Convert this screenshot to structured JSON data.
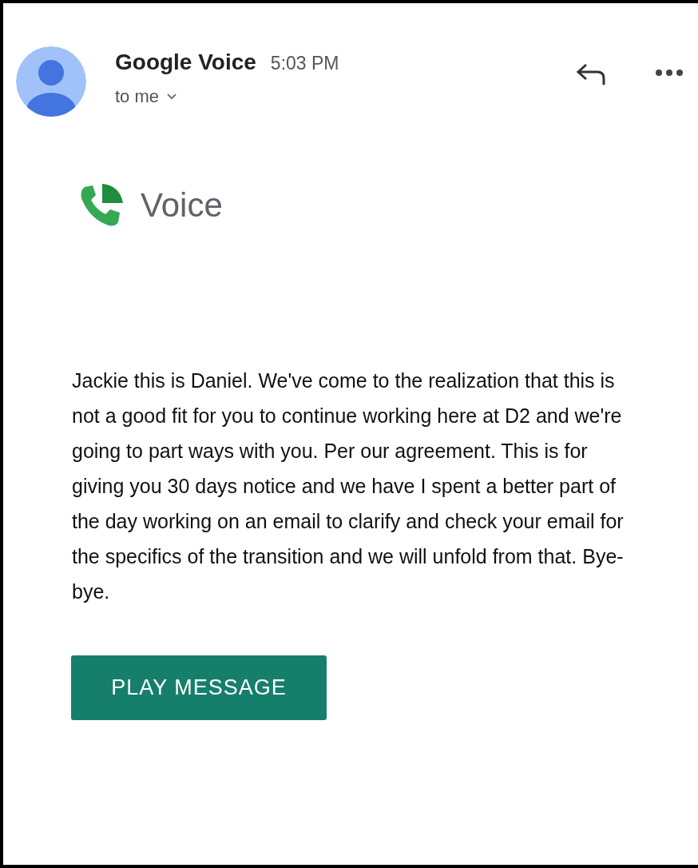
{
  "sender": {
    "name": "Google Voice",
    "time": "5:03 PM",
    "recipient": "to me"
  },
  "logo": {
    "text": "Voice"
  },
  "message": {
    "text": "Jackie this is Daniel. We've come to the realization that this is not a good fit for you to continue working here at D2 and we're going to part ways with you. Per our agreement. This is for giving you 30 days notice and we have I spent a better part of the day working on an email to clarify and check your email for the specifics of the transition and we will unfold from that. Bye-bye."
  },
  "buttons": [
    "PLAY MESSAGE"
  ]
}
